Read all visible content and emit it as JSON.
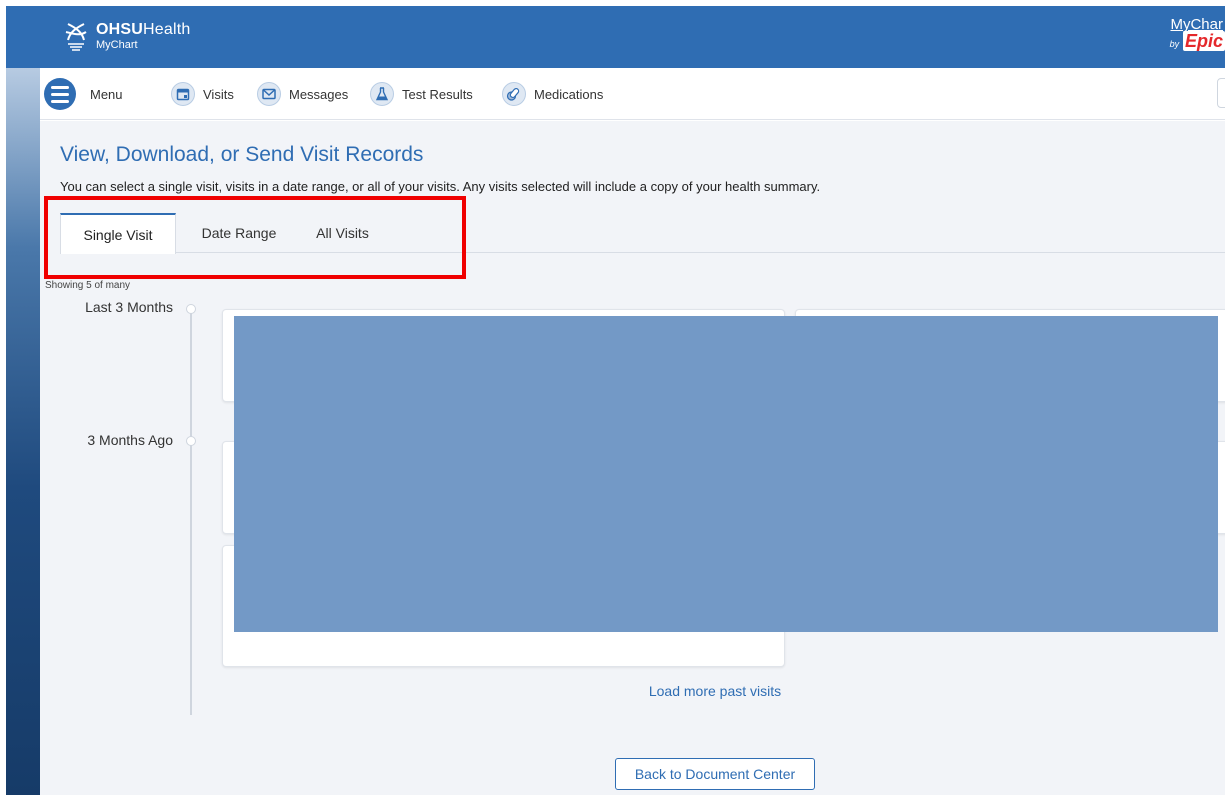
{
  "header": {
    "brand_bold": "OHSU",
    "brand_regular": "Health",
    "brand_sub": "MyChart",
    "epic_top": "MyChar",
    "epic_by": "by",
    "epic_name": "Epic"
  },
  "nav": {
    "items": [
      {
        "label": "Menu",
        "icon": "menu-icon"
      },
      {
        "label": "Visits",
        "icon": "calendar-icon"
      },
      {
        "label": "Messages",
        "icon": "envelope-icon"
      },
      {
        "label": "Test Results",
        "icon": "flask-icon"
      },
      {
        "label": "Medications",
        "icon": "pill-icon"
      }
    ]
  },
  "page": {
    "title": "View, Download, or Send Visit Records",
    "subtitle": "You can select a single visit, visits in a date range, or all of your visits. Any visits selected will include a copy of your health summary.",
    "tabs": [
      {
        "label": "Single Visit",
        "active": true
      },
      {
        "label": "Date Range",
        "active": false
      },
      {
        "label": "All Visits",
        "active": false
      }
    ],
    "showing": "Showing 5 of many",
    "timeline": [
      {
        "label": "Last 3 Months"
      },
      {
        "label": "3 Months Ago"
      }
    ],
    "load_more": "Load more past visits",
    "back_button": "Back to Document Center"
  },
  "colors": {
    "brand_blue": "#2f6db3",
    "highlight": "#f00000",
    "redaction": "#7399c6"
  }
}
